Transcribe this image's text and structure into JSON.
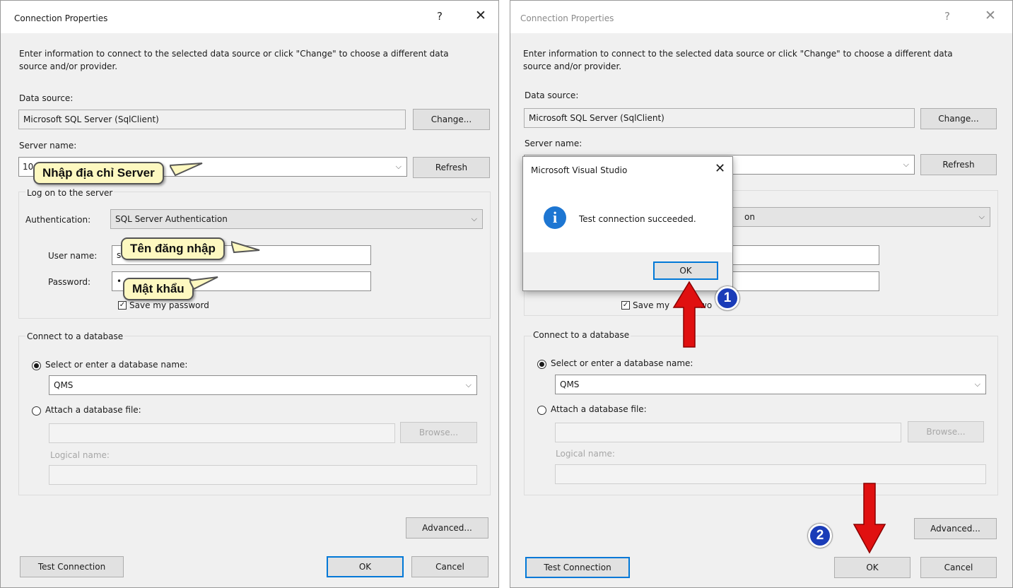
{
  "left_dialog": {
    "title": "Connection Properties",
    "help_glyph": "?",
    "close_glyph": "✕",
    "description": "Enter information to connect to the selected data source or click \"Change\" to choose a different data source and/or provider.",
    "data_source_label": "Data source:",
    "data_source_value": "Microsoft SQL Server (SqlClient)",
    "change_button": "Change...",
    "server_name_label": "Server name:",
    "server_name_value": "10",
    "refresh_button": "Refresh",
    "logon_group_label": "Log on to the server",
    "authentication_label": "Authentication:",
    "authentication_value": "SQL Server Authentication",
    "username_label": "User name:",
    "username_value": "s",
    "password_label": "Password:",
    "password_value": "•",
    "save_password_label": "Save my password",
    "connect_db_group_label": "Connect to a database",
    "select_db_label": "Select or enter a database name:",
    "database_value": "QMS",
    "attach_db_label": "Attach a database file:",
    "browse_button": "Browse...",
    "logical_name_label": "Logical name:",
    "advanced_button": "Advanced...",
    "test_connection_button": "Test Connection",
    "ok_button": "OK",
    "cancel_button": "Cancel"
  },
  "callouts": {
    "server": "Nhập địa chỉ Server",
    "username": "Tên đăng nhập",
    "password": "Mật khẩu"
  },
  "right_dialog": {
    "title": "Connection Properties",
    "help_glyph": "?",
    "close_glyph": "✕",
    "description": "Enter information to connect to the selected data source or click \"Change\" to choose a different data source and/or provider.",
    "data_source_label": "Data source:",
    "data_source_value": "Microsoft SQL Server (SqlClient)",
    "change_button": "Change...",
    "server_name_label": "Server name:",
    "refresh_button": "Refresh",
    "authentication_partial": "on",
    "save_password_partial": "Save my",
    "save_password_tail": "wo",
    "connect_db_group_label": "Connect to a database",
    "select_db_label": "Select or enter a database name:",
    "database_value": "QMS",
    "attach_db_label": "Attach a database file:",
    "browse_button": "Browse...",
    "logical_name_label": "Logical name:",
    "advanced_button": "Advanced...",
    "test_connection_button": "Test Connection",
    "ok_button": "OK",
    "cancel_button": "Cancel"
  },
  "message_box": {
    "title": "Microsoft Visual Studio",
    "close_glyph": "✕",
    "message": "Test connection succeeded.",
    "ok_button": "OK"
  },
  "badges": {
    "step1": "1",
    "step2": "2"
  },
  "colors": {
    "dialog_bg": "#f0f0f0",
    "accent_blue": "#0078d7",
    "callout_bg": "#fdf8c0",
    "arrow_red": "#e01010",
    "badge_blue": "#1a3cb8",
    "info_icon_blue": "#1d76d2"
  }
}
